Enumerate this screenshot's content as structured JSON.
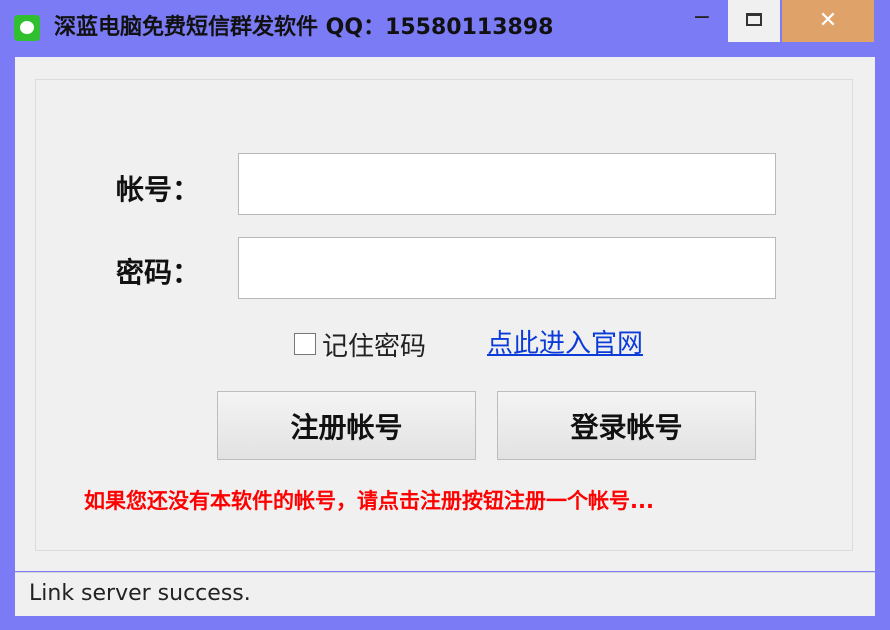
{
  "window": {
    "title": "深蓝电脑免费短信群发软件  QQ：15580113898",
    "icon": "chat-bubble-icon",
    "controls": {
      "minimize": "−",
      "close": "✕"
    }
  },
  "form": {
    "account_label": "帐号：",
    "password_label": "密码：",
    "account_value": "",
    "password_value": "",
    "remember_label": "记住密码",
    "website_link": "点此进入官网",
    "register_button": "注册帐号",
    "login_button": "登录帐号",
    "notice": "如果您还没有本软件的帐号，请点击注册按钮注册一个帐号..."
  },
  "status": {
    "text": "Link server success."
  },
  "colors": {
    "frame": "#7b7bf6",
    "close_button": "#dfa36a",
    "notice": "#ff0000",
    "link": "#0b3bd8"
  }
}
